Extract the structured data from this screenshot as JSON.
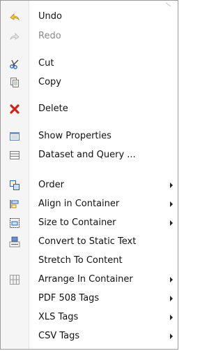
{
  "menu": {
    "items": [
      {
        "label": "Undo",
        "icon": "undo-icon"
      },
      {
        "label": "Redo",
        "icon": "redo-icon",
        "disabled": true
      },
      {
        "label": "Cut",
        "icon": "scissors-icon"
      },
      {
        "label": "Copy",
        "icon": "copy-icon"
      },
      {
        "label": "Delete",
        "icon": "delete-icon"
      },
      {
        "label": "Show Properties",
        "icon": "properties-icon"
      },
      {
        "label": "Dataset and Query ...",
        "icon": "dataset-icon"
      },
      {
        "label": "Order",
        "icon": "order-icon",
        "submenu": true
      },
      {
        "label": "Align in Container",
        "icon": "align-icon",
        "submenu": true
      },
      {
        "label": "Size to Container",
        "icon": "size-icon",
        "submenu": true
      },
      {
        "label": "Convert to Static Text",
        "icon": "label-icon"
      },
      {
        "label": "Stretch To Content"
      },
      {
        "label": "Arrange In Container",
        "icon": "grid-icon",
        "submenu": true
      },
      {
        "label": "PDF 508 Tags",
        "submenu": true
      },
      {
        "label": "XLS Tags",
        "submenu": true
      },
      {
        "label": "CSV Tags",
        "submenu": true
      }
    ]
  },
  "colors": {
    "undo": "#d6a21a",
    "delete": "#d0211c",
    "scissors": "#2a63b8",
    "icon_gray": "#8d8d8d"
  }
}
